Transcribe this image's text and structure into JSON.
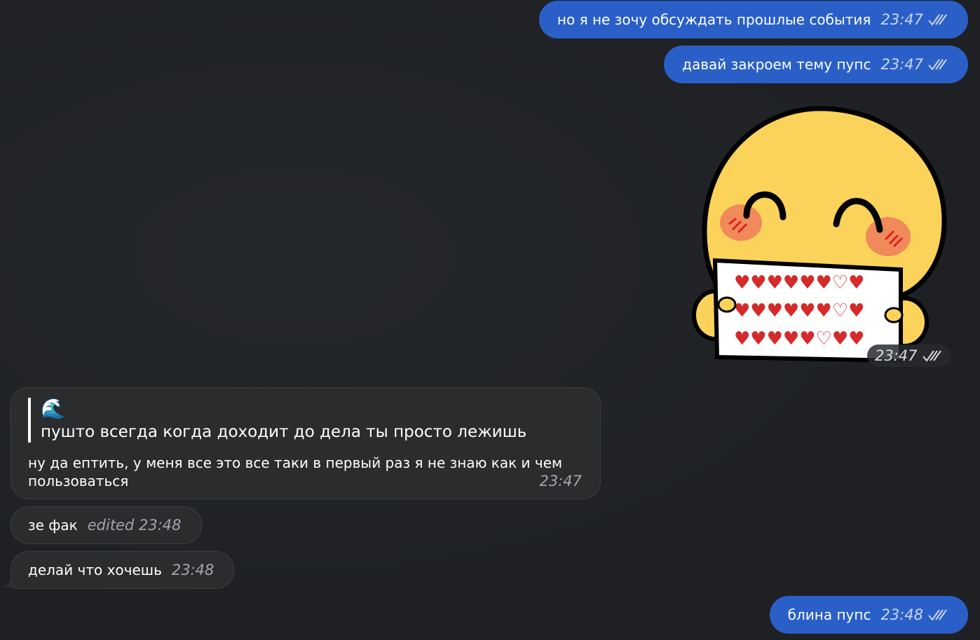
{
  "messages": {
    "m1": {
      "text": "но я не зочу обсуждать прошлые события",
      "time": "23:47",
      "check_icon": "double-check-icon"
    },
    "m2": {
      "text": "давай закроем тему пупс",
      "time": "23:47",
      "check_icon": "double-check-icon"
    },
    "sticker": {
      "description_icon": "blushing-emoji-holding-hearts-sign",
      "time": "23:47",
      "check_icon": "double-check-icon"
    },
    "m3": {
      "quote_emoji": "🌊",
      "quote_text": "пушто всегда когда доходит до дела ты просто лежишь",
      "text": "ну да ептить, у меня все это все таки в первый раз я не знаю как и чем пользоваться",
      "time": "23:47"
    },
    "m4": {
      "text": "зе фак",
      "time": "edited 23:48"
    },
    "m5": {
      "text": "делай что хочешь",
      "time": "23:48"
    },
    "m6": {
      "text": "блина пупс",
      "time": "23:48",
      "check_icon": "double-check-icon"
    }
  },
  "colors": {
    "background": "#1f2124",
    "outgoing_bubble": "#2a5fc7",
    "incoming_bubble": "#2b2c2e"
  }
}
